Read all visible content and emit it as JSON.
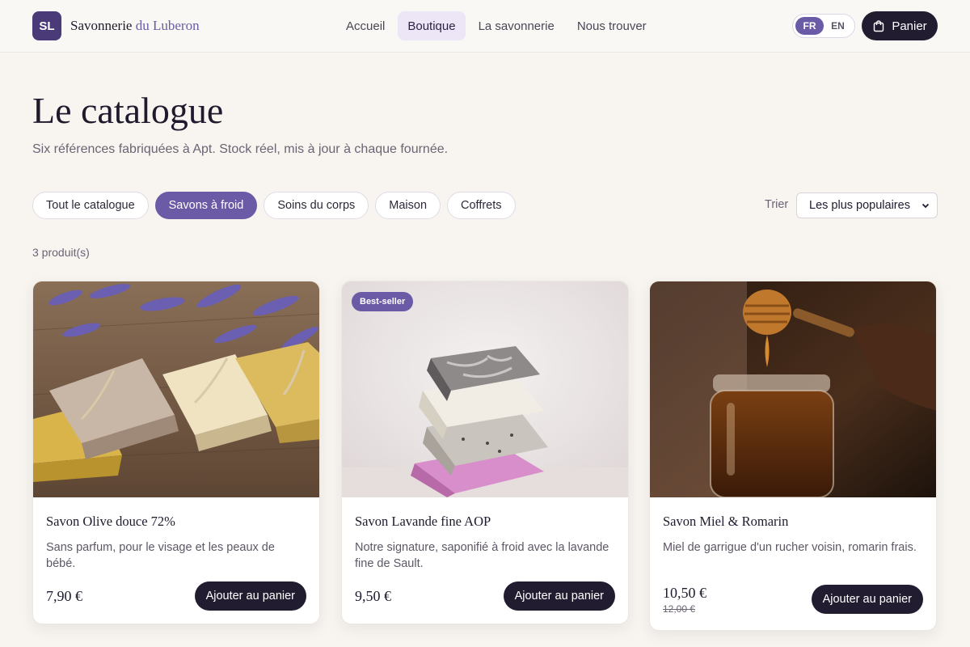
{
  "header": {
    "logo_initials": "SL",
    "brand_name": "Savonnerie",
    "brand_accent": "du Luberon",
    "nav": [
      {
        "label": "Accueil",
        "active": false
      },
      {
        "label": "Boutique",
        "active": true
      },
      {
        "label": "La savonnerie",
        "active": false
      },
      {
        "label": "Nous trouver",
        "active": false
      }
    ],
    "languages": [
      {
        "label": "FR",
        "active": true
      },
      {
        "label": "EN",
        "active": false
      }
    ],
    "cart_label": "Panier",
    "cart_icon": "shopping-bag-icon"
  },
  "page": {
    "title": "Le catalogue",
    "subtitle": "Six références fabriquées à Apt. Stock réel, mis à jour à chaque fournée."
  },
  "filters": [
    {
      "label": "Tout le catalogue",
      "active": false
    },
    {
      "label": "Savons à froid",
      "active": true
    },
    {
      "label": "Soins du corps",
      "active": false
    },
    {
      "label": "Maison",
      "active": false
    },
    {
      "label": "Coffrets",
      "active": false
    }
  ],
  "sort": {
    "label": "Trier",
    "selected": "Les plus populaires"
  },
  "result_count": "3 produit(s)",
  "products": [
    {
      "name": "Savon Olive douce 72%",
      "description": "Sans parfum, pour le visage et les peaux de bébé.",
      "price": "7,90 €",
      "old_price": "",
      "badge": "",
      "button": "Ajouter au panier",
      "image": "soap-bars-with-lavender-photo"
    },
    {
      "name": "Savon Lavande fine AOP",
      "description": "Notre signature, saponifié à froid avec la lavande fine de Sault.",
      "price": "9,50 €",
      "old_price": "",
      "badge": "Best-seller",
      "button": "Ajouter au panier",
      "image": "stacked-soap-bars-photo"
    },
    {
      "name": "Savon Miel & Romarin",
      "description": "Miel de garrigue d'un rucher voisin, romarin frais.",
      "price": "10,50 €",
      "old_price": "12,00 €",
      "badge": "",
      "button": "Ajouter au panier",
      "image": "honey-jar-dipper-photo"
    }
  ],
  "colors": {
    "accent": "#6b5aa6",
    "dark": "#221c30",
    "background": "#f8f5f0"
  }
}
